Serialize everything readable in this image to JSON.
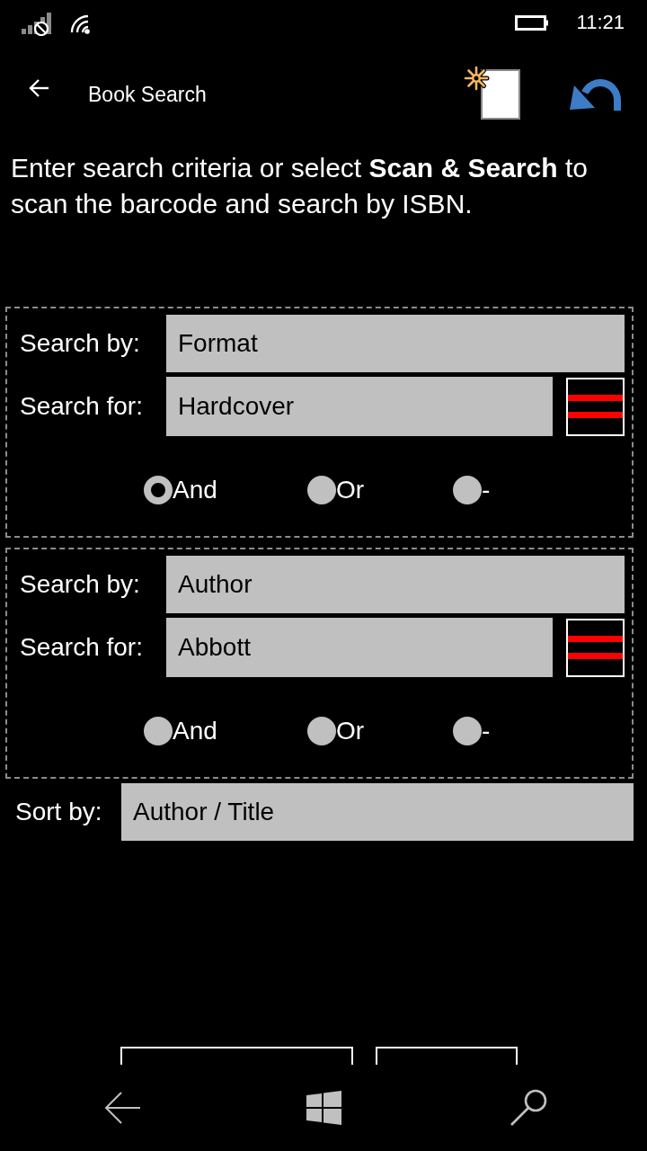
{
  "status_bar": {
    "time": "11:21"
  },
  "app_bar": {
    "title": "Book Search"
  },
  "instructions": "Enter search criteria or select **Scan & Search** to scan the barcode and search by ISBN.",
  "criteria": [
    {
      "search_by_label": "Search by:",
      "search_by": "Format",
      "search_for_label": "Search for:",
      "search_for": "Hardcover",
      "operators": [
        {
          "label": "And",
          "selected": true
        },
        {
          "label": "Or",
          "selected": false
        },
        {
          "label": "-",
          "selected": false
        }
      ]
    },
    {
      "search_by_label": "Search by:",
      "search_by": "Author",
      "search_for_label": "Search for:",
      "search_for": "Abbott",
      "operators": [
        {
          "label": "And",
          "selected": false
        },
        {
          "label": "Or",
          "selected": false
        },
        {
          "label": "-",
          "selected": false
        }
      ]
    }
  ],
  "sort": {
    "label": "Sort by:",
    "value": "Author / Title"
  }
}
